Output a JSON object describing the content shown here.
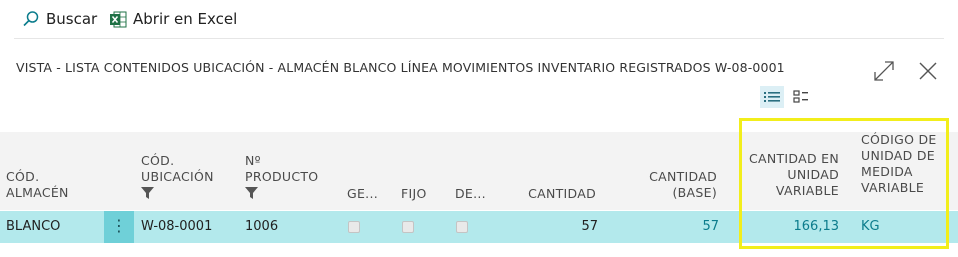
{
  "toolbar": {
    "search_label": "Buscar",
    "excel_label": "Abrir en Excel"
  },
  "title": "VISTA - LISTA CONTENIDOS UBICACIÓN - ALMACÉN BLANCO LÍNEA MOVIMIENTOS INVENTARIO REGISTRADOS W-08-0001",
  "columns": {
    "almacen": [
      "CÓD.",
      "ALMACÉN"
    ],
    "ubicacion": [
      "CÓD.",
      "UBICACIÓN"
    ],
    "producto": [
      "Nº",
      "PRODUCTO"
    ],
    "ge": "GE...",
    "fijo": "FIJO",
    "de": "DE...",
    "cantidad": "CANTIDAD",
    "cantidad_base": [
      "CANTIDAD",
      "(BASE)"
    ],
    "cantidad_var": [
      "CANTIDAD EN",
      "UNIDAD",
      "VARIABLE"
    ],
    "codigo_var": [
      "CÓDIGO DE",
      "UNIDAD DE",
      "MEDIDA",
      "VARIABLE"
    ]
  },
  "row": {
    "almacen": "BLANCO",
    "ubicacion": "W-08-0001",
    "producto": "1006",
    "cantidad": "57",
    "cantidad_base": "57",
    "cantidad_var": "166,13",
    "codigo_var": "KG",
    "more_icon": "⋮"
  },
  "colors": {
    "row_bg": "#b3e9ec",
    "accent_teal": "#0b7c8c",
    "highlight": "#f2ee1b",
    "excel_green": "#1e7145"
  },
  "icons": [
    "search-icon",
    "excel-icon",
    "expand-icon",
    "close-icon",
    "list-view-icon",
    "tile-view-icon",
    "filter-icon"
  ]
}
